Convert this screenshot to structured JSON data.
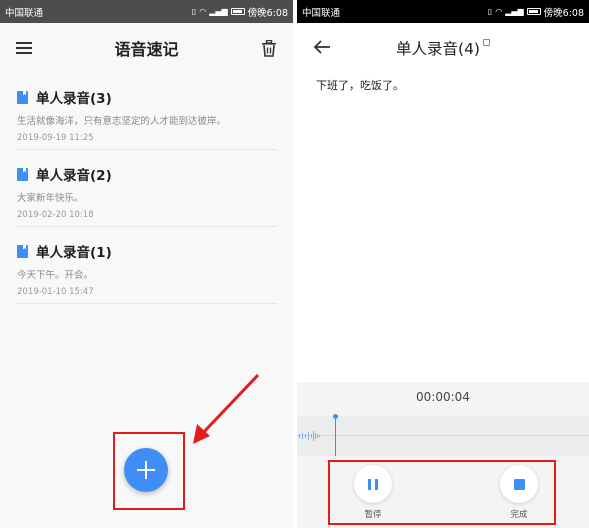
{
  "left": {
    "status": {
      "carrier": "中国联通",
      "time": "傍晚6:08"
    },
    "app_title": "语音速记",
    "notes": [
      {
        "title": "单人录音(3)",
        "text": "生活就像海洋，只有意志坚定的人才能到达彼岸。",
        "date": "2019-09-19 11:25"
      },
      {
        "title": "单人录音(2)",
        "text": "大家新年快乐。",
        "date": "2019-02-20 10:18"
      },
      {
        "title": "单人录音(1)",
        "text": "今天下午。开会。",
        "date": "2019-01-10 15:47"
      }
    ]
  },
  "right": {
    "status": {
      "carrier": "中国联通",
      "time": "傍晚6:08"
    },
    "title": "单人录音(4)",
    "body": "下班了，吃饭了。",
    "timer": "00:00:04",
    "pause_label": "暂停",
    "finish_label": "完成"
  },
  "colors": {
    "accent": "#3d8ff5",
    "highlight": "#e31b1b"
  },
  "icons": [
    "menu-icon",
    "trash-icon",
    "note-bookmark-icon",
    "plus-icon",
    "back-arrow-icon",
    "edit-icon",
    "pause-icon",
    "stop-icon",
    "signal-icon",
    "wifi-icon",
    "battery-icon"
  ]
}
